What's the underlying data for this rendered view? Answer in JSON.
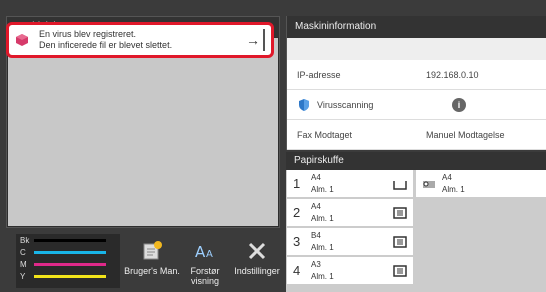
{
  "notice": {
    "title": "Meddelelse",
    "line1": "En virus blev registreret.",
    "line2": "Den inficerede fil er blevet slettet."
  },
  "machine_info": {
    "title": "Maskininformation",
    "rows": [
      {
        "label": "IP-adresse",
        "value": "192.168.0.10"
      },
      {
        "label": "Virusscanning",
        "value": ""
      },
      {
        "label": "Fax Modtaget",
        "value": "Manuel Modtagelse"
      }
    ]
  },
  "paper_tray": {
    "title": "Papirskuffe",
    "trays": [
      {
        "num": "1",
        "size": "A4",
        "type": "Alm. 1"
      },
      {
        "num": "2",
        "size": "A4",
        "type": "Alm. 1"
      },
      {
        "num": "3",
        "size": "B4",
        "type": "Alm. 1"
      },
      {
        "num": "4",
        "size": "A3",
        "type": "Alm. 1"
      }
    ],
    "bypass": {
      "size": "A4",
      "type": "Alm. 1"
    }
  },
  "toner": [
    {
      "label": "Bk",
      "color": "#000000"
    },
    {
      "label": "C",
      "color": "#19b5e8"
    },
    {
      "label": "M",
      "color": "#e0298a"
    },
    {
      "label": "Y",
      "color": "#f2e41a"
    }
  ],
  "buttons": {
    "manual": "Bruger's Man.",
    "zoom": "Forstør visning",
    "settings": "Indstillinger"
  }
}
